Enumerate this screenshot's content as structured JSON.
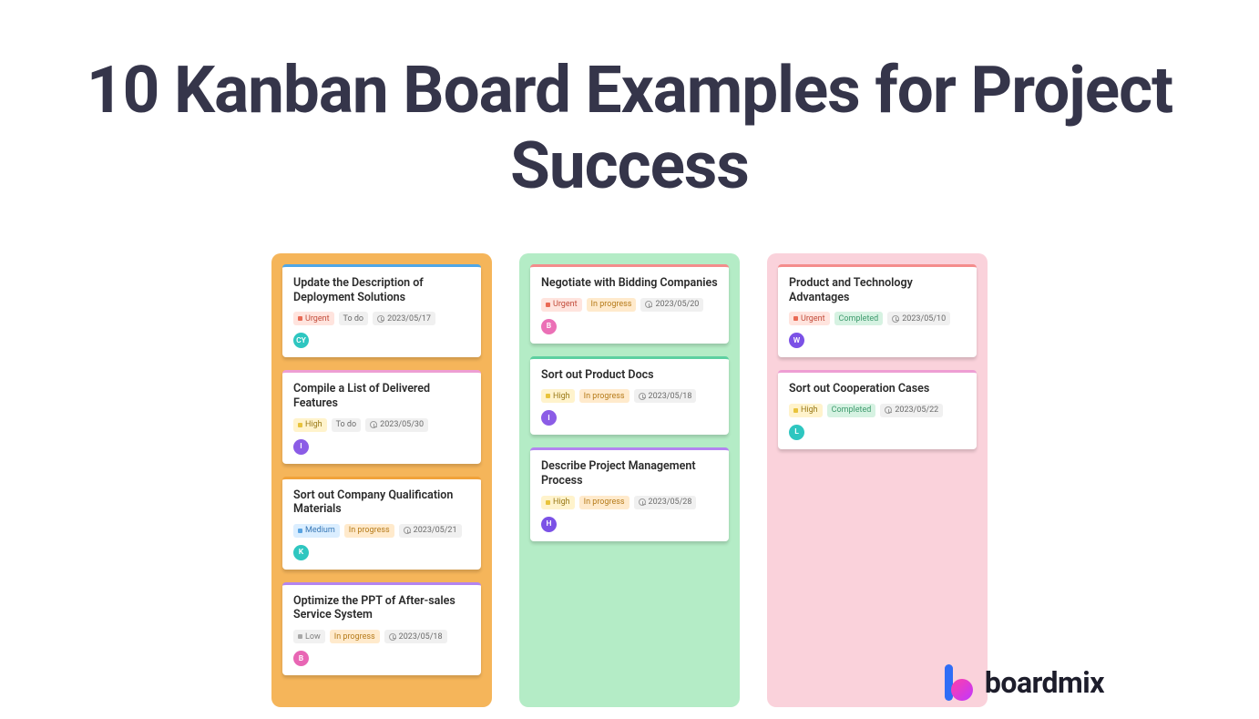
{
  "title": "10 Kanban Board Examples for Project Success",
  "brand": "boardmix",
  "columns": [
    {
      "color": "orange",
      "cards": [
        {
          "accent": "blue",
          "title": "Update the Description of Deployment Solutions",
          "priority": {
            "label": "Urgent",
            "cls": "prio-urgent"
          },
          "status": {
            "label": "To do",
            "cls": ""
          },
          "date": "2023/05/17",
          "avatar": {
            "txt": "CY",
            "cls": "av-teal"
          }
        },
        {
          "accent": "pink",
          "title": "Compile a List of Delivered Features",
          "priority": {
            "label": "High",
            "cls": "prio-high"
          },
          "status": {
            "label": "To do",
            "cls": ""
          },
          "date": "2023/05/30",
          "avatar": {
            "txt": "I",
            "cls": "av-purple"
          }
        },
        {
          "accent": "orange",
          "title": "Sort out Company Qualification Materials",
          "priority": {
            "label": "Medium",
            "cls": "prio-medium"
          },
          "status": {
            "label": "In progress",
            "cls": "status-inprogress"
          },
          "date": "2023/05/21",
          "avatar": {
            "txt": "K",
            "cls": "av-teal"
          }
        },
        {
          "accent": "purple",
          "title": "Optimize the PPT of After-sales Service System",
          "priority": {
            "label": "Low",
            "cls": "prio-low"
          },
          "status": {
            "label": "In progress",
            "cls": "status-inprogress"
          },
          "date": "2023/05/18",
          "avatar": {
            "txt": "B",
            "cls": "av-pink"
          }
        }
      ]
    },
    {
      "color": "green",
      "cards": [
        {
          "accent": "red",
          "title": "Negotiate with Bidding Companies",
          "priority": {
            "label": "Urgent",
            "cls": "prio-urgent"
          },
          "status": {
            "label": "In progress",
            "cls": "status-inprogress"
          },
          "date": "2023/05/20",
          "avatar": {
            "txt": "B",
            "cls": "av-pink2"
          }
        },
        {
          "accent": "green",
          "title": "Sort out Product Docs",
          "priority": {
            "label": "High",
            "cls": "prio-high"
          },
          "status": {
            "label": "In progress",
            "cls": "status-inprogress"
          },
          "date": "2023/05/18",
          "avatar": {
            "txt": "I",
            "cls": "av-purple"
          }
        },
        {
          "accent": "purple",
          "title": "Describe Project Management Process",
          "priority": {
            "label": "High",
            "cls": "prio-high"
          },
          "status": {
            "label": "In progress",
            "cls": "status-inprogress"
          },
          "date": "2023/05/28",
          "avatar": {
            "txt": "H",
            "cls": "av-violet"
          }
        }
      ]
    },
    {
      "color": "pink",
      "cards": [
        {
          "accent": "red",
          "title": "Product and Technology Advantages",
          "priority": {
            "label": "Urgent",
            "cls": "prio-urgent"
          },
          "status": {
            "label": "Completed",
            "cls": "status-completed"
          },
          "date": "2023/05/10",
          "avatar": {
            "txt": "W",
            "cls": "av-violet"
          }
        },
        {
          "accent": "pink",
          "title": "Sort out Cooperation Cases",
          "priority": {
            "label": "High",
            "cls": "prio-high"
          },
          "status": {
            "label": "Completed",
            "cls": "status-completed"
          },
          "date": "2023/05/22",
          "avatar": {
            "txt": "L",
            "cls": "av-teal"
          }
        }
      ]
    }
  ]
}
